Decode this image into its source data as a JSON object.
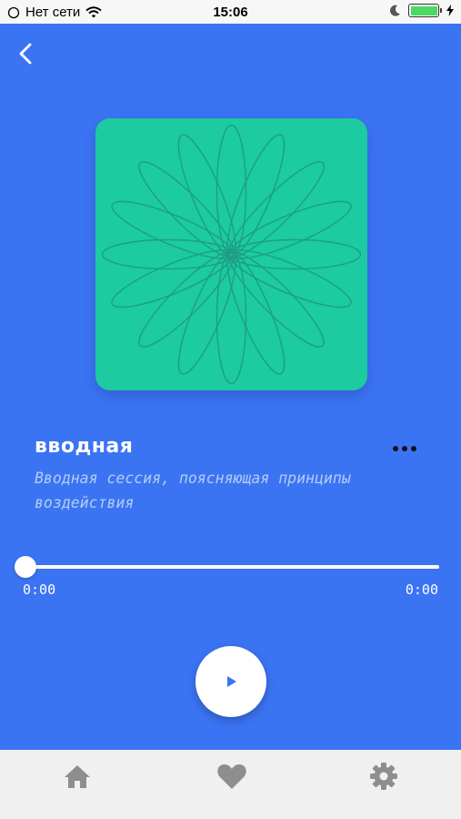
{
  "status_bar": {
    "carrier": "Нет сети",
    "time": "15:06",
    "icons": [
      "wifi-icon",
      "moon-icon",
      "battery-icon",
      "charging-icon"
    ]
  },
  "header": {
    "back_icon": "chevron-left-icon"
  },
  "track": {
    "title": "вводная",
    "description": "Вводная сессия, поясняющая принципы воздействия",
    "cover_icon": "flower-pattern"
  },
  "player": {
    "current_time": "0:00",
    "total_time": "0:00",
    "progress": 0,
    "play_icon": "play-icon"
  },
  "tabbar": {
    "items": [
      {
        "icon": "home-icon"
      },
      {
        "icon": "heart-icon"
      },
      {
        "icon": "gear-icon"
      }
    ]
  },
  "colors": {
    "background": "#3B74F3",
    "cover": "#1CCBA0",
    "cover_lines": "#1E9E84",
    "tabbar": "#F0F0F0",
    "tab_icon": "#8E8E8E",
    "subtitle": "#B3CDF8"
  }
}
